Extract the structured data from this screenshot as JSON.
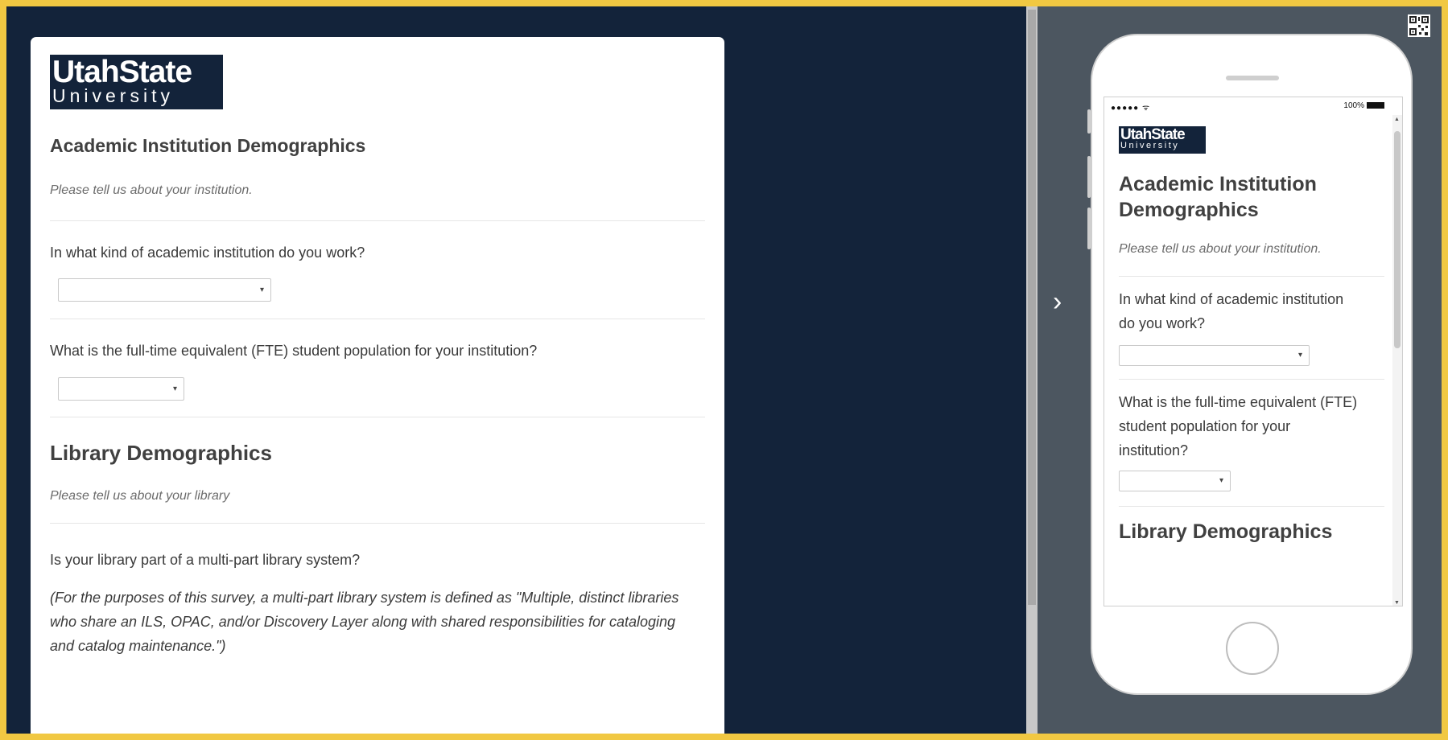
{
  "logo": {
    "line1": "UtahState",
    "line2": "University"
  },
  "survey": {
    "section1": {
      "title": "Academic Institution Demographics",
      "intro": "Please tell us about your institution."
    },
    "q1": {
      "text": "In what kind of academic institution do you work?",
      "value": ""
    },
    "q2": {
      "text": "What is the full-time equivalent (FTE) student population for your institution?",
      "value": ""
    },
    "section2": {
      "title": "Library Demographics",
      "intro": "Please tell us about your library"
    },
    "q3": {
      "text": "Is your library part of a multi-part library system?",
      "note": "(For the purposes of this survey, a multi-part library system is defined as \"Multiple, distinct libraries who share an ILS, OPAC, and/or Discovery Layer along with shared responsibilities for cataloging and catalog maintenance.\")"
    }
  },
  "preview": {
    "status_signal": "●●●●● ᯤ",
    "status_battery": "100%"
  },
  "icons": {
    "select_arrow": "▾",
    "chevron": "›",
    "scroll_up": "▲",
    "scroll_down": "▼"
  },
  "colors": {
    "frame_border": "#f1c842",
    "background": "#13233a",
    "preview_bg": "#4c5660"
  }
}
